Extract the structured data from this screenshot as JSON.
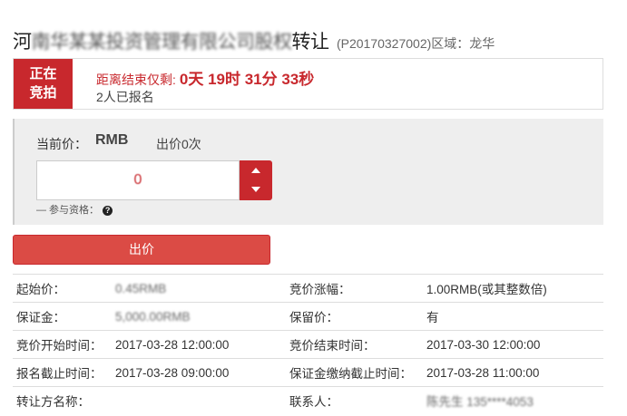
{
  "header": {
    "title_start": "河",
    "title_blurred": "南华某某投资管理有限公司股权",
    "title_end": "转让",
    "project_code": "(P20170327002)区域：龙华"
  },
  "status": {
    "badge_line1": "正在",
    "badge_line2": "竞拍",
    "countdown_label": "距离结束仅剩:",
    "countdown_value": "0天 19时 31分 33秒",
    "signup_text": "2人已报名"
  },
  "bid_panel": {
    "current_price_label": "当前价：",
    "current_price_value": "RMB",
    "bid_count_text": "出价0次",
    "bid_input_value": "0",
    "qualification_label": "— 参与资格：",
    "help_glyph": "?"
  },
  "actions": {
    "bid_button_label": "出价"
  },
  "info": {
    "rows": [
      {
        "label1": "起始价：",
        "value1": "0.45RMB",
        "label2": "竞价涨幅：",
        "value2": "1.00RMB(或其整数倍)"
      },
      {
        "label1": "保证金：",
        "value1": "5,000.00RMB",
        "label2": "保留价：",
        "value2": "有"
      },
      {
        "label1": "竞价开始时间：",
        "value1": "2017-03-28 12:00:00",
        "label2": "竞价结束时间：",
        "value2": "2017-03-30 12:00:00"
      },
      {
        "label1": "报名截止时间：",
        "value1": "2017-03-28 09:00:00",
        "label2": "保证金缴纳截止时间：",
        "value2": "2017-03-28 11:00:00"
      },
      {
        "label1": "转让方名称：",
        "value1": "",
        "label2": "联系人：",
        "value2": "陈先生 135****4053"
      }
    ]
  },
  "colors": {
    "accent_red": "#c8282d",
    "button_red": "#db4b45",
    "panel_gray": "#eeeeee"
  },
  "icons": {
    "stepper_up": "triangle-up",
    "stepper_down": "triangle-down",
    "help": "question-circle"
  }
}
